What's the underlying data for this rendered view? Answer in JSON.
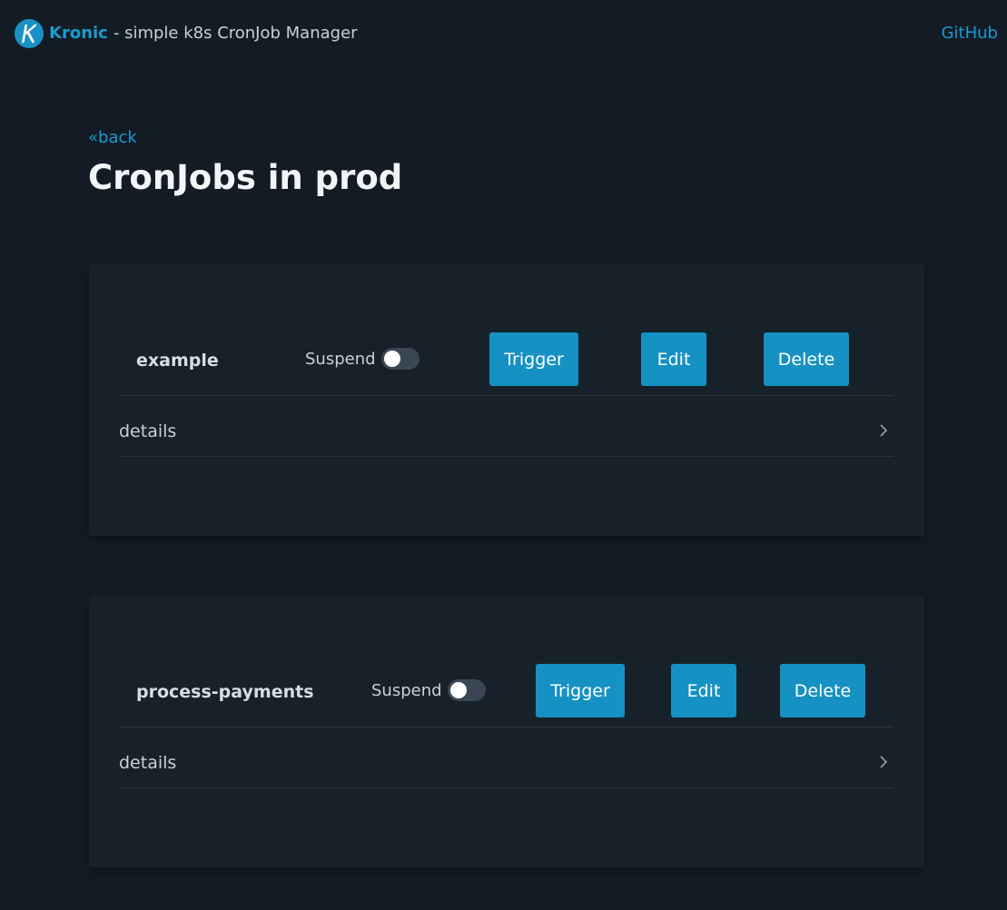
{
  "header": {
    "brand_name": "Kronic",
    "brand_subtitle": "- simple k8s CronJob Manager",
    "github_label": "GitHub"
  },
  "nav": {
    "back_label": "«back"
  },
  "page": {
    "title": "CronJobs in prod"
  },
  "cronjobs": [
    {
      "name": "example",
      "suspend_label": "Suspend",
      "suspended": false,
      "trigger_label": "Trigger",
      "edit_label": "Edit",
      "delete_label": "Delete",
      "details_label": "details"
    },
    {
      "name": "process-payments",
      "suspend_label": "Suspend",
      "suspended": false,
      "trigger_label": "Trigger",
      "edit_label": "Edit",
      "delete_label": "Delete",
      "details_label": "details"
    }
  ],
  "colors": {
    "background": "#131c25",
    "card": "#17212a",
    "accent": "#1691c3"
  }
}
